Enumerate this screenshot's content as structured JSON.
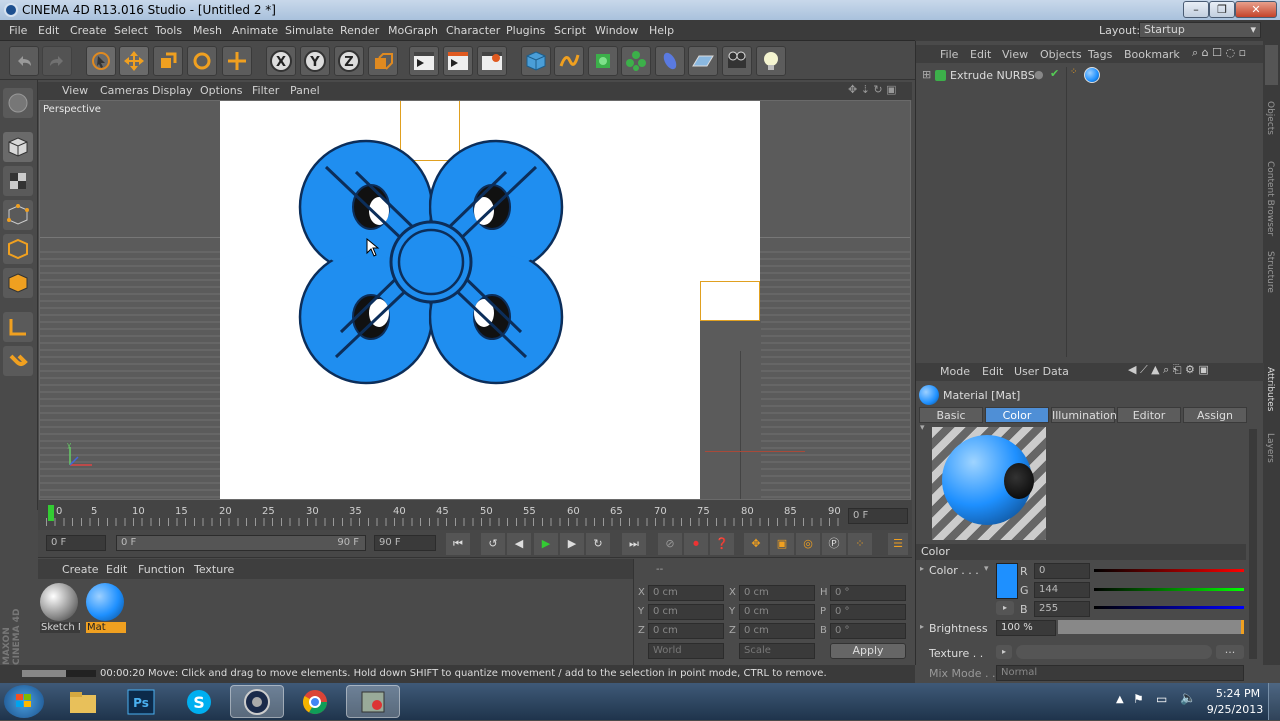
{
  "window": {
    "title": "CINEMA 4D R13.016 Studio - [Untitled 2 *]"
  },
  "menu": [
    "File",
    "Edit",
    "Create",
    "Select",
    "Tools",
    "Mesh",
    "Animate",
    "Simulate",
    "Render",
    "MoGraph",
    "Character",
    "Plugins",
    "Script",
    "Window",
    "Help"
  ],
  "layout": {
    "label": "Layout:",
    "value": "Startup"
  },
  "viewport": {
    "menu": [
      "View",
      "Cameras",
      "Display",
      "Options",
      "Filter",
      "Panel"
    ],
    "label": "Perspective"
  },
  "timeline": {
    "ticks": [
      "0",
      "5",
      "10",
      "15",
      "20",
      "25",
      "30",
      "35",
      "40",
      "45",
      "50",
      "55",
      "60",
      "65",
      "70",
      "75",
      "80",
      "85",
      "90"
    ],
    "current_frame": "0 F"
  },
  "transport": {
    "start": "0 F",
    "range_start": "0 F",
    "range_end": "90 F",
    "end": "90 F"
  },
  "material_manager": {
    "menu": [
      "Create",
      "Edit",
      "Function",
      "Texture"
    ],
    "materials": [
      {
        "name": "Sketch M"
      },
      {
        "name": "Mat"
      }
    ]
  },
  "coordinates": {
    "top": "--",
    "rows": [
      {
        "a": "X",
        "av": "0 cm",
        "b": "X",
        "bv": "0 cm",
        "c": "H",
        "cv": "0 °"
      },
      {
        "a": "Y",
        "av": "0 cm",
        "b": "Y",
        "bv": "0 cm",
        "c": "P",
        "cv": "0 °"
      },
      {
        "a": "Z",
        "av": "0 cm",
        "b": "Z",
        "bv": "0 cm",
        "c": "B",
        "cv": "0 °"
      }
    ],
    "mode1": "World",
    "mode2": "Scale",
    "apply": "Apply"
  },
  "status": {
    "time": "00:00:20",
    "message": "Move: Click and drag to move elements. Hold down SHIFT to quantize movement / add to the selection in point mode, CTRL to remove."
  },
  "objects": {
    "menu": [
      "File",
      "Edit",
      "View",
      "Objects",
      "Tags",
      "Bookmark"
    ],
    "items": [
      {
        "name": "Extrude NURBS"
      }
    ]
  },
  "attributes": {
    "menu": [
      "Mode",
      "Edit",
      "User Data"
    ],
    "title": "Material [Mat]",
    "tabs": [
      "Basic",
      "Color",
      "Illumination",
      "Editor",
      "Assign"
    ],
    "active_tab": "Color",
    "section": "Color",
    "color_label": "Color . . .",
    "r_label": "R",
    "r": "0",
    "g_label": "G",
    "g": "144",
    "b_label": "B",
    "b": "255",
    "brightness_label": "Brightness",
    "brightness": "100 %",
    "texture_label": "Texture . .",
    "mix_label": "Mix Mode . .",
    "mix_value": "Normal",
    "swatch": "#1e90ff"
  },
  "side_tabs": [
    "Objects",
    "Content Browser",
    "Structure",
    "Attributes",
    "Layers"
  ],
  "brand": "MAXON CINEMA 4D",
  "taskbar": {
    "time": "5:24 PM",
    "date": "9/25/2013"
  }
}
